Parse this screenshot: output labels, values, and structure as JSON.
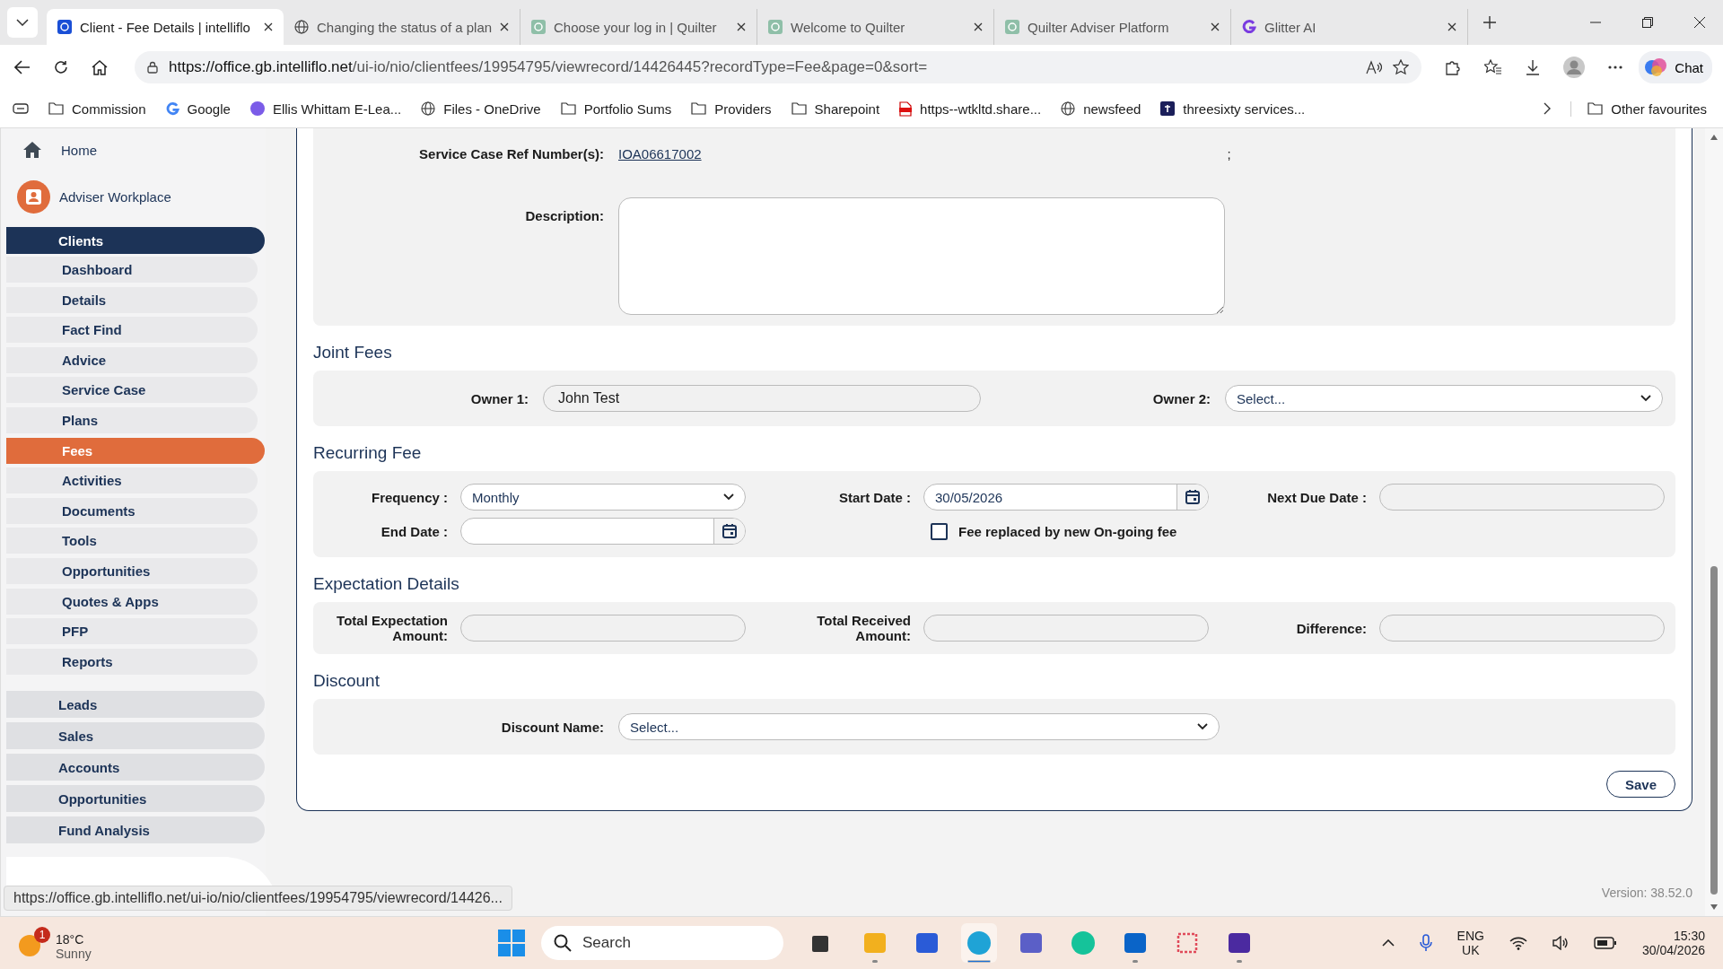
{
  "browser": {
    "tabs": [
      {
        "title": "Client - Fee Details | intelliflo",
        "kind": "intelliflo",
        "selected": true
      },
      {
        "title": "Changing the status of a plan",
        "kind": "globe",
        "selected": false
      },
      {
        "title": "Choose your log in | Quilter",
        "kind": "quilter",
        "selected": false
      },
      {
        "title": "Welcome to Quilter",
        "kind": "quilter",
        "selected": false
      },
      {
        "title": "Quilter Adviser Platform",
        "kind": "quilter",
        "selected": false
      },
      {
        "title": "Glitter AI",
        "kind": "glitter",
        "selected": false
      }
    ],
    "address": {
      "host": "https://office.gb.intelliflo.net",
      "path": "/ui-io/nio/clientfees/19954795/viewrecord/14426445?recordType=Fee&page=0&sort="
    },
    "chat_label": "Chat",
    "bookmarks": [
      {
        "label": "Commission",
        "kind": "folder"
      },
      {
        "label": "Google",
        "kind": "google"
      },
      {
        "label": "Ellis Whittam E-Lea...",
        "kind": "ew"
      },
      {
        "label": "Files - OneDrive",
        "kind": "globe"
      },
      {
        "label": "Portfolio Sums",
        "kind": "folder"
      },
      {
        "label": "Providers",
        "kind": "folder"
      },
      {
        "label": "Sharepoint",
        "kind": "folder"
      },
      {
        "label": "https--wtkltd.share...",
        "kind": "pdf"
      },
      {
        "label": "newsfeed",
        "kind": "globe"
      },
      {
        "label": "threesixty services...",
        "kind": "t"
      }
    ],
    "other_favourites": "Other favourites",
    "status_url": "https://office.gb.intelliflo.net/ui-io/nio/clientfees/19954795/viewrecord/14426..."
  },
  "sidebar": {
    "home": "Home",
    "workplace": "Adviser Workplace",
    "groups": [
      {
        "label": "Clients",
        "expanded": true,
        "children": [
          {
            "label": "Dashboard",
            "selected": false
          },
          {
            "label": "Details",
            "selected": false
          },
          {
            "label": "Fact Find",
            "selected": false
          },
          {
            "label": "Advice",
            "selected": false
          },
          {
            "label": "Service Case",
            "selected": false
          },
          {
            "label": "Plans",
            "selected": false
          },
          {
            "label": "Fees",
            "selected": true
          },
          {
            "label": "Activities",
            "selected": false
          },
          {
            "label": "Documents",
            "selected": false
          },
          {
            "label": "Tools",
            "selected": false
          },
          {
            "label": "Opportunities",
            "selected": false
          },
          {
            "label": "Quotes & Apps",
            "selected": false
          },
          {
            "label": "PFP",
            "selected": false
          },
          {
            "label": "Reports",
            "selected": false
          }
        ]
      },
      {
        "label": "Leads",
        "expanded": false
      },
      {
        "label": "Sales",
        "expanded": false
      },
      {
        "label": "Accounts",
        "expanded": false
      },
      {
        "label": "Opportunities",
        "expanded": false
      },
      {
        "label": "Fund Analysis",
        "expanded": false
      }
    ]
  },
  "form": {
    "service_case": {
      "label": "Service Case Ref Number(s):",
      "link": "IOA06617002",
      "note": ";"
    },
    "description": {
      "label": "Description:"
    },
    "joint_fees": {
      "title": "Joint Fees",
      "owner_1": {
        "label": "Owner 1:",
        "value": "John Test"
      },
      "owner_2": {
        "label": "Owner 2:",
        "value": "Select..."
      }
    },
    "recurring_fee": {
      "title": "Recurring Fee",
      "frequency": {
        "label": "Frequency :",
        "value": "Monthly"
      },
      "start_date": {
        "label": "Start Date :",
        "value": "30/05/2026"
      },
      "next_due_date": {
        "label": "Next Due Date :"
      },
      "end_date": {
        "label": "End Date :"
      },
      "replaced": {
        "label": "Fee replaced by new On-going fee",
        "checked": false
      }
    },
    "expectation": {
      "title": "Expectation Details",
      "total_expectation": {
        "label": "Total Expectation Amount:"
      },
      "total_received": {
        "label": "Total Received Amount:"
      },
      "difference": {
        "label": "Difference:"
      }
    },
    "discount": {
      "title": "Discount",
      "name": {
        "label": "Discount Name:",
        "value": "Select..."
      }
    },
    "save": "Save"
  },
  "version": "Version: 38.52.0",
  "taskbar": {
    "weather": {
      "temp": "18°C",
      "condition": "Sunny",
      "badge": "1"
    },
    "search": {
      "placeholder": "Search"
    },
    "apps": [
      {
        "kind": "taskview",
        "running": false,
        "selected": false
      },
      {
        "kind": "explorer",
        "running": true,
        "selected": false
      },
      {
        "kind": "store",
        "running": false,
        "selected": false
      },
      {
        "kind": "edge",
        "running": true,
        "selected": true
      },
      {
        "kind": "teams",
        "running": false,
        "selected": false
      },
      {
        "kind": "grammarly",
        "running": false,
        "selected": false
      },
      {
        "kind": "outlook",
        "running": true,
        "selected": false
      },
      {
        "kind": "snip",
        "running": false,
        "selected": false
      },
      {
        "kind": "glitter",
        "running": true,
        "selected": false
      }
    ],
    "language": [
      "ENG",
      "UK"
    ],
    "time": "15:30",
    "date": "30/04/2026"
  }
}
